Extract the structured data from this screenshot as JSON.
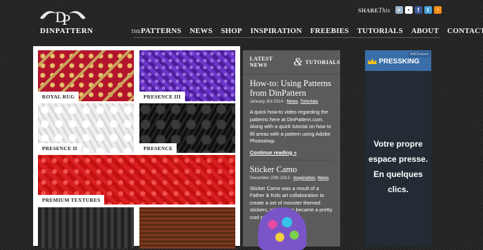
{
  "header": {
    "logo_text": "DINPATTERN",
    "share_label": "SHARE",
    "share_italic": "This"
  },
  "nav": {
    "items": [
      {
        "prefix": "THE",
        "label": "PATTERNS"
      },
      {
        "prefix": "",
        "label": "NEWS"
      },
      {
        "prefix": "",
        "label": "SHOP"
      },
      {
        "prefix": "",
        "label": "INSPIRATION"
      },
      {
        "prefix": "",
        "label": "FREEBIES"
      },
      {
        "prefix": "",
        "label": "TUTORIALS"
      },
      {
        "prefix": "",
        "label": "ABOUT"
      },
      {
        "prefix": "",
        "label": "CONTACT"
      }
    ]
  },
  "patterns": [
    {
      "label": "ROYAL RUG"
    },
    {
      "label": "PRESENCE III"
    },
    {
      "label": "PRESENCE II"
    },
    {
      "label": "PRESENCE"
    },
    {
      "label": "PREMIUM TEXTURES"
    }
  ],
  "news": {
    "heading_left": "LATEST NEWS",
    "heading_amp": "&",
    "heading_right": "TUTORIALS",
    "articles": [
      {
        "title": "How-to: Using Patterns from DinPattern",
        "date": "January 3rd 2014 - ",
        "cat1": "News",
        "cat2": "Tutorials",
        "body": "A quick how-to video regarding the patterns here at DinPattern.com. Along with a quick tutorial on how to fill areas with a pattern using Adobe Photoshop.",
        "more": "Continue reading »"
      },
      {
        "title": "Sticker Camo",
        "date": "December 20th 2013 - ",
        "cat1": "Inspiration",
        "cat2": "News",
        "body": "Sticker Camo was a result of a Father & Kids art collaboration to create a set of monster themed stickers, which then became a pretty cool pattern."
      }
    ]
  },
  "ad": {
    "badge": "AdChoices",
    "brand": "PRESSKING",
    "text_lines": [
      "Votre propre",
      "espace presse.",
      "En quelques",
      "clics."
    ]
  }
}
